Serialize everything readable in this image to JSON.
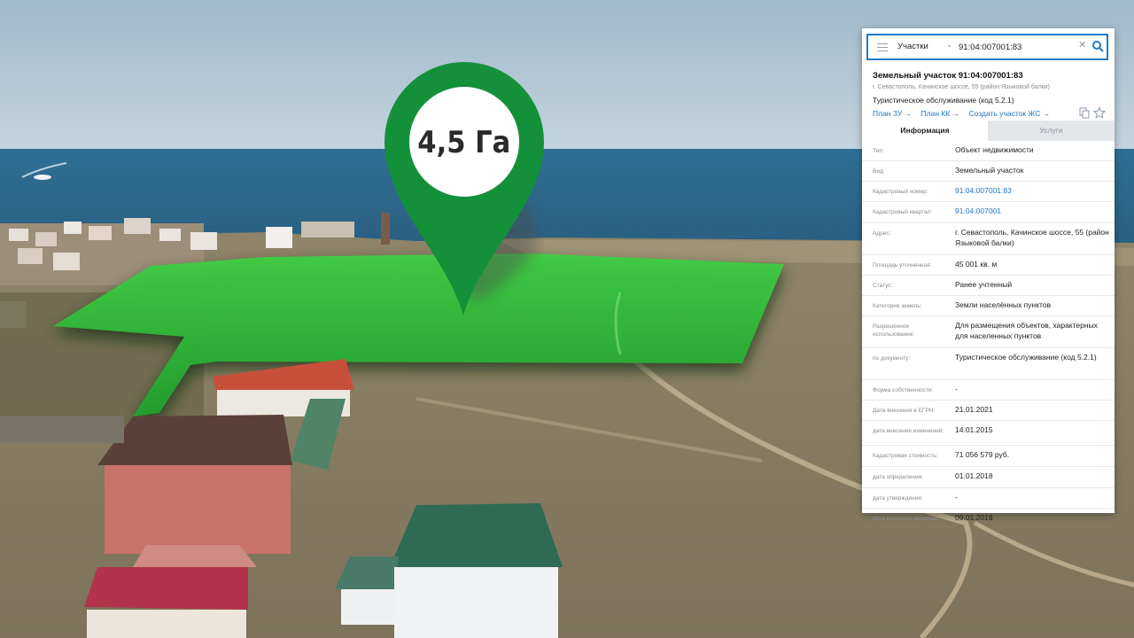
{
  "marker": {
    "label": "4,5 Га"
  },
  "colors": {
    "marker_green": "#14903a",
    "parcel_green": "#33c23c",
    "accent_blue": "#1e7bc4",
    "link_blue": "#1e73be"
  },
  "panel": {
    "search": {
      "layer_select": "Участки",
      "query": "91:04:007001:83",
      "icons": [
        "menu-icon",
        "chevron-down-icon",
        "clear-icon",
        "search-icon"
      ]
    },
    "object": {
      "title": "Земельный участок 91:04:007001:83",
      "address": "г. Севастополь, Качинское шоссе, 55 (район Языковой балки)",
      "use": "Туристическое обслуживание (код 5.2.1)",
      "links": [
        "План ЗУ →",
        "План КК →",
        "Создать участок ЖС →"
      ],
      "action_icons": [
        "copy-icon",
        "star-icon"
      ]
    },
    "tabs": [
      "Информация",
      "Услуги"
    ],
    "rows": [
      {
        "label": "Тип:",
        "value": "Объект недвижимости"
      },
      {
        "label": "Вид:",
        "value": "Земельный участок"
      },
      {
        "label": "Кадастровый номер:",
        "value": "91:04:007001:83"
      },
      {
        "label": "Кадастровый квартал:",
        "value": "91:04:007001"
      },
      {
        "label": "Адрес:",
        "value": "г. Севастополь, Качинское шоссе, 55 (район Языковой балки)"
      },
      {
        "label": "Площадь уточненная:",
        "value": "45 001 кв. м"
      },
      {
        "label": "Статус:",
        "value": "Ранее учтенный"
      },
      {
        "label": "Категория земель:",
        "value": "Земли населённых пунктов"
      },
      {
        "label": "Разрешенное использование:",
        "value": "Для размещения объектов, характерных для населенных пунктов"
      },
      {
        "label": "по документу:",
        "value": "Туристическое обслуживание (код 5.2.1)"
      },
      {
        "label": "Форма собственности:",
        "value": "-"
      },
      {
        "label": "Дата внесения в ЕГРН:",
        "value": "21.01.2021"
      },
      {
        "label": "дата внесения изменений:",
        "value": "14.01.2015"
      },
      {
        "label": "Кадастровая стоимость:",
        "value": "71 056 579 руб."
      },
      {
        "label": "дата определения:",
        "value": "01.01.2018"
      },
      {
        "label": "дата утверждения:",
        "value": "-"
      },
      {
        "label": "дата внесения сведений:",
        "value": "09.01.2019"
      }
    ]
  }
}
